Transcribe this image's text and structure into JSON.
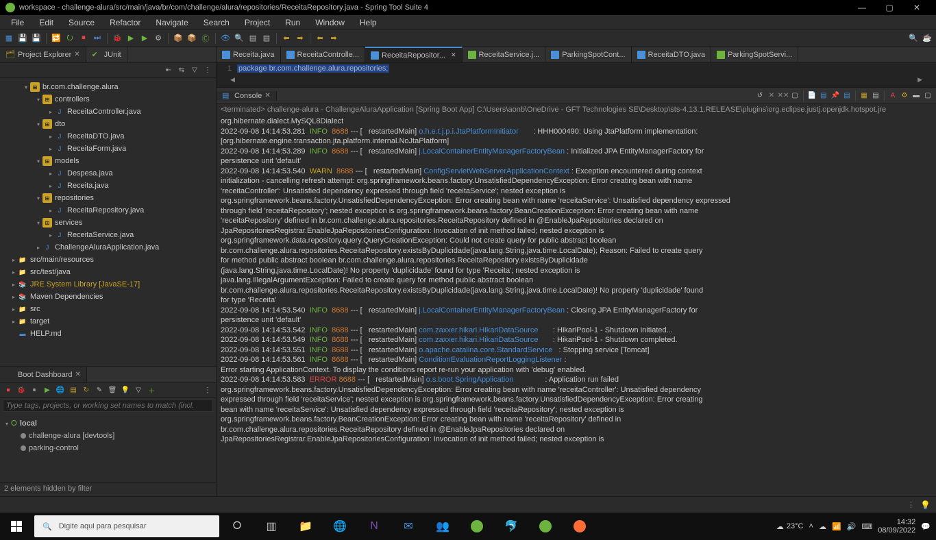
{
  "titlebar": {
    "text": "workspace - challenge-alura/src/main/java/br/com/challenge/alura/repositories/ReceitaRepository.java - Spring Tool Suite 4"
  },
  "menu": [
    "File",
    "Edit",
    "Source",
    "Refactor",
    "Navigate",
    "Search",
    "Project",
    "Run",
    "Window",
    "Help"
  ],
  "project_explorer": {
    "title": "Project Explorer",
    "junit": "JUnit",
    "nodes": {
      "pkg0": "br.com.challenge.alura",
      "controllers": "controllers",
      "rc": "ReceitaController.java",
      "dto": "dto",
      "rdto": "ReceitaDTO.java",
      "rform": "ReceitaForm.java",
      "models": "models",
      "desp": "Despesa.java",
      "rec": "Receita.java",
      "repos": "repositories",
      "rrepo": "ReceitaRepository.java",
      "services": "services",
      "rsvc": "ReceitaService.java",
      "app": "ChallengeAluraApplication.java",
      "res": "src/main/resources",
      "test": "src/test/java",
      "jre": "JRE System Library [JavaSE-17]",
      "maven": "Maven Dependencies",
      "src": "src",
      "target": "target",
      "help": "HELP.md"
    }
  },
  "editor": {
    "tabs": [
      "Receita.java",
      "ReceitaControlle...",
      "ReceitaRepositor...",
      "ReceitaService.j...",
      "ParkingSpotCont...",
      "ReceitaDTO.java",
      "ParkingSpotServi..."
    ],
    "line1": "package br.com.challenge.alura.repositories;"
  },
  "console": {
    "title": "Console",
    "terminated": "<terminated> challenge-alura - ChallengeAluraApplication [Spring Boot App] C:\\Users\\aonb\\OneDrive - GFT Technologies SE\\Desktop\\sts-4.13.1.RELEASE\\plugins\\org.eclipse.justj.openjdk.hotspot.jre"
  },
  "chart_data": null,
  "log": [
    {
      "ts": "2022-09-08 14:14:53.281",
      "lvl": "INFO",
      "pid": "8688",
      "thread": "restartedMain",
      "logger": "o.h.e.t.j.p.i.JtaPlatformInitiator",
      "msg": ": HHH000490: Using JtaPlatform implementation:"
    },
    {
      "plain": "[org.hibernate.engine.transaction.jta.platform.internal.NoJtaPlatform]"
    },
    {
      "ts": "2022-09-08 14:14:53.289",
      "lvl": "INFO",
      "pid": "8688",
      "thread": "restartedMain",
      "logger": "j.LocalContainerEntityManagerFactoryBean",
      "msg": ": Initialized JPA EntityManagerFactory for"
    },
    {
      "plain": "persistence unit 'default'"
    },
    {
      "ts": "2022-09-08 14:14:53.540",
      "lvl": "WARN",
      "pid": "8688",
      "thread": "restartedMain",
      "logger": "ConfigServletWebServerApplicationContext",
      "msg": ": Exception encountered during context"
    },
    {
      "plain": "initialization - cancelling refresh attempt: org.springframework.beans.factory.UnsatisfiedDependencyException: Error creating bean with name"
    },
    {
      "plain": "'receitaController': Unsatisfied dependency expressed through field 'receitaService'; nested exception is"
    },
    {
      "plain": "org.springframework.beans.factory.UnsatisfiedDependencyException: Error creating bean with name 'receitaService': Unsatisfied dependency expressed"
    },
    {
      "plain": "through field 'receitaRepository'; nested exception is org.springframework.beans.factory.BeanCreationException: Error creating bean with name"
    },
    {
      "plain": "'receitaRepository' defined in br.com.challenge.alura.repositories.ReceitaRepository defined in @EnableJpaRepositories declared on"
    },
    {
      "plain": "JpaRepositoriesRegistrar.EnableJpaRepositoriesConfiguration: Invocation of init method failed; nested exception is"
    },
    {
      "plain": "org.springframework.data.repository.query.QueryCreationException: Could not create query for public abstract boolean"
    },
    {
      "plain": "br.com.challenge.alura.repositories.ReceitaRepository.existsByDuplicidade(java.lang.String,java.time.LocalDate); Reason: Failed to create query"
    },
    {
      "plain": "for method public abstract boolean br.com.challenge.alura.repositories.ReceitaRepository.existsByDuplicidade"
    },
    {
      "plain": "(java.lang.String,java.time.LocalDate)! No property 'duplicidade' found for type 'Receita'; nested exception is"
    },
    {
      "plain": "java.lang.IllegalArgumentException: Failed to create query for method public abstract boolean"
    },
    {
      "plain": "br.com.challenge.alura.repositories.ReceitaRepository.existsByDuplicidade(java.lang.String,java.time.LocalDate)! No property 'duplicidade' found"
    },
    {
      "plain": "for type 'Receita'"
    },
    {
      "ts": "2022-09-08 14:14:53.540",
      "lvl": "INFO",
      "pid": "8688",
      "thread": "restartedMain",
      "logger": "j.LocalContainerEntityManagerFactoryBean",
      "msg": ": Closing JPA EntityManagerFactory for"
    },
    {
      "plain": "persistence unit 'default'"
    },
    {
      "ts": "2022-09-08 14:14:53.542",
      "lvl": "INFO",
      "pid": "8688",
      "thread": "restartedMain",
      "logger": "com.zaxxer.hikari.HikariDataSource",
      "msg": ": HikariPool-1 - Shutdown initiated..."
    },
    {
      "ts": "2022-09-08 14:14:53.549",
      "lvl": "INFO",
      "pid": "8688",
      "thread": "restartedMain",
      "logger": "com.zaxxer.hikari.HikariDataSource",
      "msg": ": HikariPool-1 - Shutdown completed."
    },
    {
      "ts": "2022-09-08 14:14:53.551",
      "lvl": "INFO",
      "pid": "8688",
      "thread": "restartedMain",
      "logger": "o.apache.catalina.core.StandardService",
      "msg": ": Stopping service [Tomcat]"
    },
    {
      "ts": "2022-09-08 14:14:53.561",
      "lvl": "INFO",
      "pid": "8688",
      "thread": "restartedMain",
      "logger": "ConditionEvaluationReportLoggingListener",
      "msg": ":"
    },
    {
      "plain": ""
    },
    {
      "plain": "Error starting ApplicationContext. To display the conditions report re-run your application with 'debug' enabled."
    },
    {
      "ts": "2022-09-08 14:14:53.583",
      "lvl": "ERROR",
      "pid": "8688",
      "thread": "restartedMain",
      "logger": "o.s.boot.SpringApplication",
      "msg": ": Application run failed"
    },
    {
      "plain": ""
    },
    {
      "plain": "org.springframework.beans.factory.UnsatisfiedDependencyException: Error creating bean with name 'receitaController': Unsatisfied dependency"
    },
    {
      "plain": "expressed through field 'receitaService'; nested exception is org.springframework.beans.factory.UnsatisfiedDependencyException: Error creating"
    },
    {
      "plain": "bean with name 'receitaService': Unsatisfied dependency expressed through field 'receitaRepository'; nested exception is"
    },
    {
      "plain": "org.springframework.beans.factory.BeanCreationException: Error creating bean with name 'receitaRepository' defined in"
    },
    {
      "plain": "br.com.challenge.alura.repositories.ReceitaRepository defined in @EnableJpaRepositories declared on"
    },
    {
      "plain": "JpaRepositoriesRegistrar.EnableJpaRepositoriesConfiguration: Invocation of init method failed; nested exception is"
    }
  ],
  "boot": {
    "title": "Boot Dashboard",
    "placeholder": "Type tags, projects, or working set names to match (incl.",
    "local": "local",
    "app1": "challenge-alura [devtools]",
    "app2": "parking-control",
    "status": "2 elements hidden by filter"
  },
  "taskbar": {
    "search": "Digite aqui para pesquisar",
    "temp": "23°C",
    "time": "14:32",
    "date": "08/09/2022"
  }
}
